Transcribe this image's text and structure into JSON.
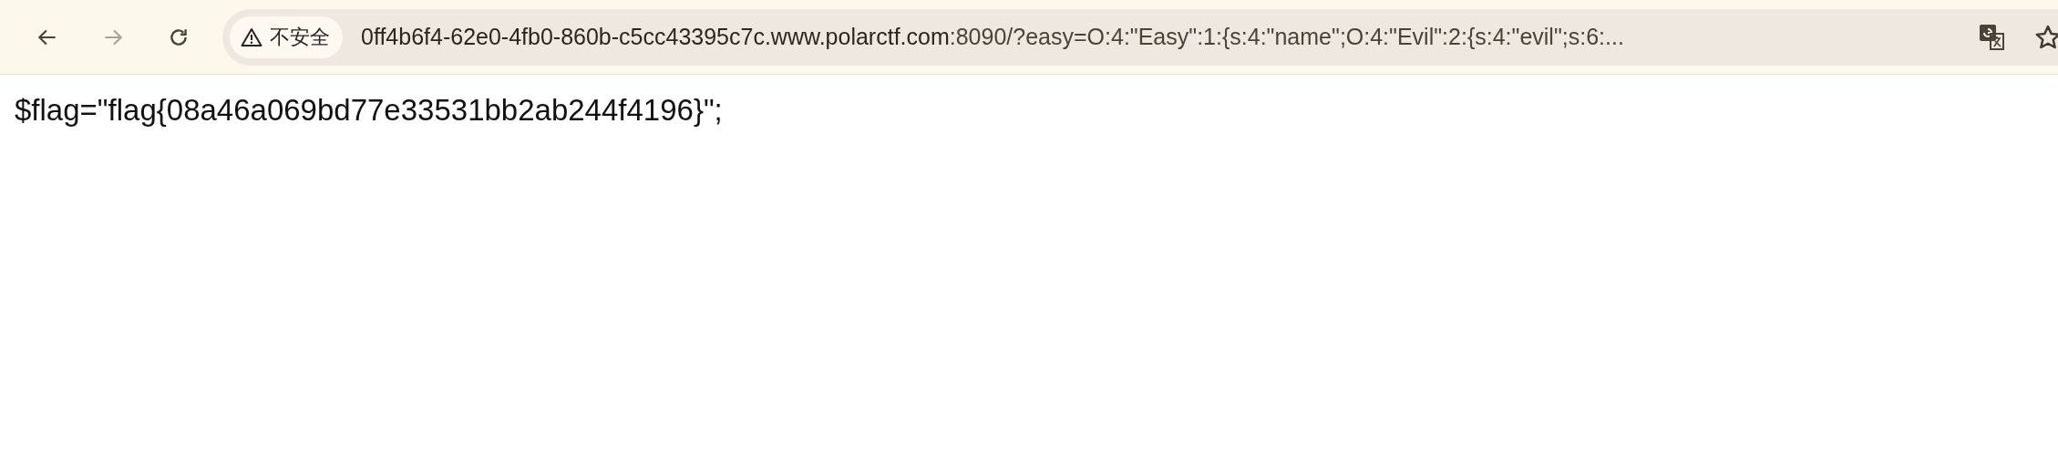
{
  "toolbar": {
    "back": {
      "disabled": false
    },
    "forward": {
      "disabled": true
    }
  },
  "address_bar": {
    "security_label": "不安全",
    "url_host": "0ff4b6f4-62e0-4fb0-860b-c5cc43395c7c.www.polarctf.com",
    "url_rest": ":8090/?easy=O:4:\"Easy\":1:{s:4:\"name\";O:4:\"Evil\":2:{s:4:\"evil\";s:6:..."
  },
  "page": {
    "text": "$flag=\"flag{08a46a069bd77e33531bb2ab244f4196}\";"
  }
}
